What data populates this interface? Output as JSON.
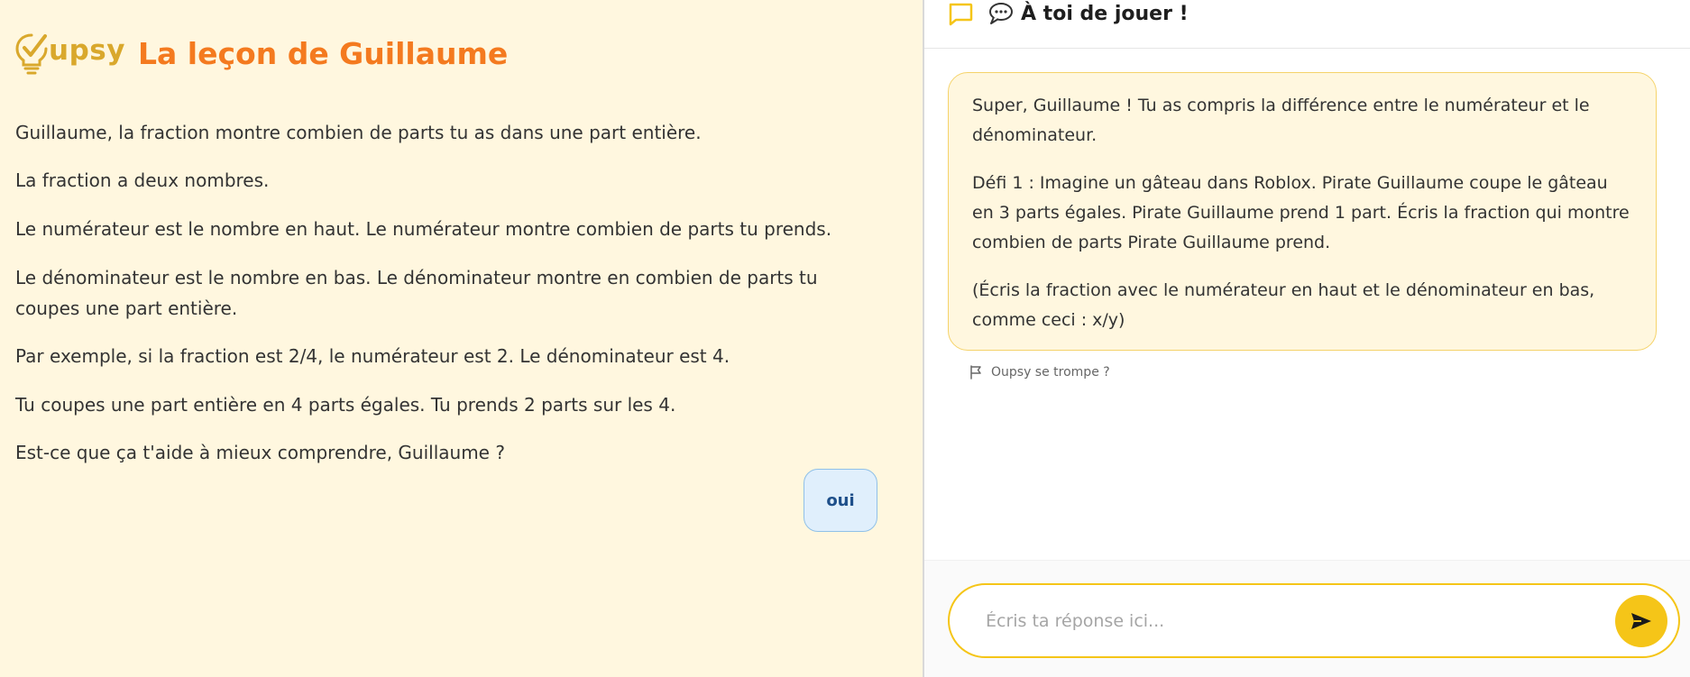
{
  "logo": {
    "text": "upsy"
  },
  "lesson": {
    "title": "La leçon de Guillaume",
    "paragraphs": [
      "Guillaume, la fraction montre combien de parts tu as dans une part entière.",
      "La fraction a deux nombres.",
      "Le numérateur est le nombre en haut. Le numérateur montre combien de parts tu prends.",
      "Le dénominateur est le nombre en bas. Le dénominateur montre en combien de parts tu coupes une part entière.",
      "Par exemple, si la fraction est 2/4, le numérateur est 2. Le dénominateur est 4.",
      "Tu coupes une part entière en 4 parts égales. Tu prends 2 parts sur les 4.",
      "Est-ce que ça t'aide à mieux comprendre, Guillaume ?"
    ],
    "answer_button": "oui"
  },
  "chat": {
    "header_title": "À toi de jouer !",
    "header_icon": "speech-bubble-icon",
    "message": {
      "paragraphs": [
        "Super, Guillaume ! Tu as compris la différence entre le numérateur et le dénominateur.",
        "Défi 1 : Imagine un gâteau dans Roblox. Pirate Guillaume coupe le gâteau en 3 parts égales. Pirate Guillaume prend 1 part. Écris la fraction qui montre combien de parts Pirate Guillaume prend.",
        "(Écris la fraction avec le numérateur en haut et le dénominateur en bas, comme ceci : x/y)"
      ]
    },
    "report_label": "Oupsy se trompe ?",
    "input": {
      "placeholder": "Écris ta réponse ici...",
      "value": ""
    },
    "send_icon": "send-icon"
  },
  "colors": {
    "left_bg": "#fff7df",
    "title_orange": "#f47a1f",
    "logo_gold": "#d9a82c",
    "accent_yellow": "#f5c518",
    "answer_bg": "#e0effc",
    "answer_text": "#1e4f8a"
  }
}
